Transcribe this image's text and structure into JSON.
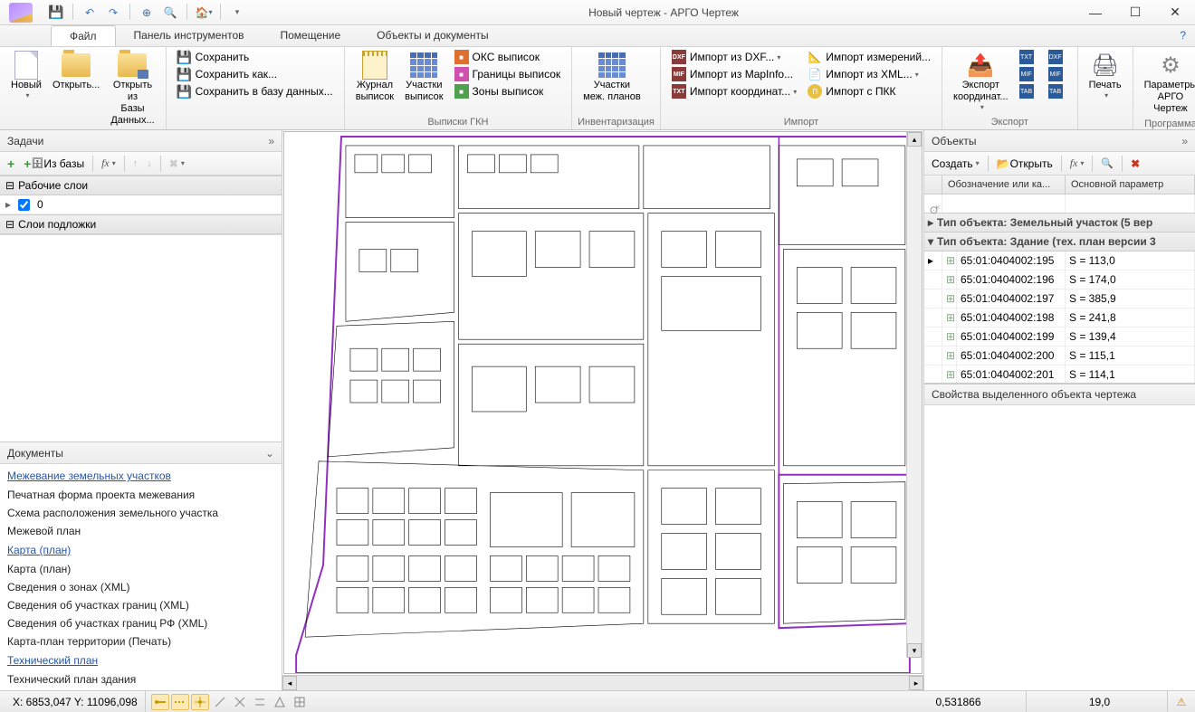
{
  "title": "Новый чертеж - АРГО Чертеж",
  "tabs": {
    "file": "Файл",
    "toolbar": "Панель инструментов",
    "room": "Помещение",
    "objects": "Объекты и документы"
  },
  "ribbon": {
    "group_file": "Файл",
    "new": "Новый",
    "open": "Открыть...",
    "open_db": "Открыть из\nБазы Данных...",
    "save": "Сохранить",
    "save_as": "Сохранить как...",
    "save_to_db": "Сохранить в базу данных...",
    "group_gkn": "Выписки ГКН",
    "journal": "Журнал\nвыписок",
    "parcels_ext": "Участки\nвыписок",
    "oks": "ОКС выписок",
    "borders": "Границы выписок",
    "zones": "Зоны выписок",
    "group_inv": "Инвентаризация",
    "parcels_plan": "Участки\nмеж. планов",
    "group_import": "Импорт",
    "imp_dxf": "Импорт из DXF...",
    "imp_mapinfo": "Импорт из MapInfo...",
    "imp_coord": "Импорт координат...",
    "imp_meas": "Импорт измерений...",
    "imp_xml": "Импорт из XML...",
    "imp_pkk": "Импорт с ПКК",
    "group_export": "Экспорт",
    "export_coord": "Экспорт\nкоординат...",
    "print": "Печать",
    "group_prog": "Программа",
    "params": "Параметры\nАРГО Чертеж"
  },
  "tasks": {
    "title": "Задачи",
    "from_db": "Из базы",
    "acc_layers": "Рабочие слои",
    "layer_value": "0",
    "acc_underlay": "Слои подложки"
  },
  "docs": {
    "title": "Документы",
    "g1": "Межевание земельных участков",
    "g1_items": [
      "Печатная форма проекта межевания",
      "Схема расположения земельного участка",
      "Межевой план"
    ],
    "g2": "Карта (план)",
    "g2_items": [
      "Карта (план)",
      "Сведения о зонах (XML)",
      "Сведения об участках границ (XML)",
      "Сведения об участках границ РФ (XML)",
      "Карта-план территории (Печать)"
    ],
    "g3": "Технический план",
    "g3_items": [
      "Технический план здания"
    ]
  },
  "objects": {
    "title": "Объекты",
    "create": "Создать",
    "open": "Открыть",
    "col1": "Обозначение или ка...",
    "col2": "Основной параметр",
    "grp1": "Тип объекта: Земельный участок (5 вер",
    "grp2": "Тип объекта: Здание (тех. план версии 3",
    "rows": [
      {
        "code": "65:01:0404002:195",
        "param": "S = 113,0"
      },
      {
        "code": "65:01:0404002:196",
        "param": "S = 174,0"
      },
      {
        "code": "65:01:0404002:197",
        "param": "S = 385,9"
      },
      {
        "code": "65:01:0404002:198",
        "param": "S = 241,8"
      },
      {
        "code": "65:01:0404002:199",
        "param": "S = 139,4"
      },
      {
        "code": "65:01:0404002:200",
        "param": "S = 115,1"
      },
      {
        "code": "65:01:0404002:201",
        "param": "S = 114,1"
      }
    ],
    "props_title": "Свойства выделенного объекта чертежа"
  },
  "status": {
    "coords": "X: 6853,047 Y: 11096,098",
    "val1": "0,531866",
    "val2": "19,0"
  }
}
